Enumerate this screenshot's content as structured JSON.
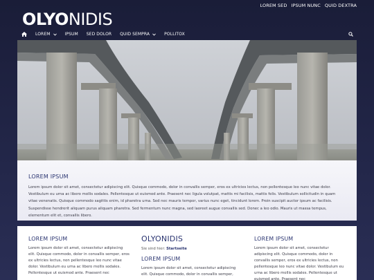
{
  "top_links": [
    "LOREM SED",
    "IPSUM NUNC",
    "QUID DEXTRA"
  ],
  "logo": {
    "bold": "OLYO",
    "light": "NIDIS"
  },
  "nav": {
    "items": [
      {
        "label": "LOREM",
        "dropdown": true
      },
      {
        "label": "IPSUM",
        "dropdown": false
      },
      {
        "label": "SED DOLOR",
        "dropdown": false
      },
      {
        "label": "QUID SEMPRA",
        "dropdown": true
      },
      {
        "label": "POLLITOX",
        "dropdown": false
      }
    ]
  },
  "intro": {
    "title": "LOREM IPSUM",
    "text": "Lorem ipsum dolor sit amet, consectetur adipiscing elit. Quisque commodo, dolor in convallis semper, eros ex ultricies lectus, non pellentesque leo nunc vitae dolor. Vestibulum eu urna ac libero mollis sodales. Pellentesque ut euismod ante. Praesent nec ligula volutpat, mattis mi facilisis, mattis felis. Vestibulum sollicitudin in quam vitae venenatis. Quisque commodo sagittis enim, id pharetra urna. Sed nec mauris tempor, varius nunc eget, tincidunt lorem. Proin suscipit auctor ipsum ac facilisis. Suspendisse hendrerit aliquam purus aliquam pharetra. Sed fermentum nunc magna, sed laoreet augue convallis sed. Donec a leo odio. Mauris ut massa tempus, elementum elit et, convallis libero."
  },
  "col1": {
    "title": "LOREM IPSUM",
    "text": "Lorem ipsum dolor sit amet, consectetur adipiscing elit. Quisque commodo, dolor in convallis semper, eros ex ultricies lectus, non pellentesque leo nunc vitae dolor. Vestibulum eu urna ac libero mollis sodales. Pellentesque ut euismod ante. Praesent nec"
  },
  "col2": {
    "heading": "OLYONIDIS",
    "crumb_prefix": "Sie sind hier:",
    "crumb_link": "Startseite",
    "title": "LOREM IPSUM",
    "text": "Lorem ipsum dolor sit amet, consectetur adipiscing elit. Quisque commodo, dolor in convallis semper,"
  },
  "col3": {
    "title": "LOREM IPSUM",
    "text": "Lorem ipsum dolor sit amet, consectetur adipiscing elit. Quisque commodo, dolor in convallis semper, eros ex ultricies lectus, non pellentesque leo nunc vitae dolor. Vestibulum eu urna ac libero mollis sodales. Pellentesque ut euismod ante. Praesent nec"
  }
}
